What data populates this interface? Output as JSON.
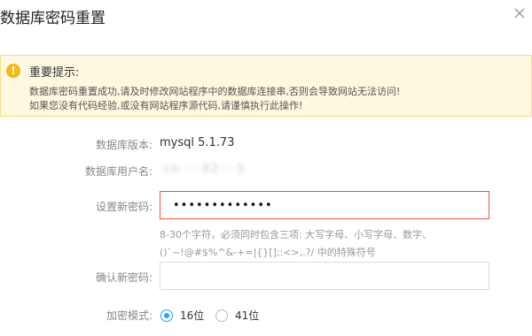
{
  "dialog": {
    "title": "数据库密码重置",
    "close_icon": "close-icon"
  },
  "notice": {
    "icon": "warning-icon",
    "icon_glyph": "!",
    "title": "重要提示:",
    "line1": "数据库密码重置成功,请及时修改网站程序中的数据库连接串,否则会导致网站无法访问!",
    "line2": "如果您没有代码经验,或没有网站程序源代码,请谨慎执行此操作!"
  },
  "form": {
    "db_version_label": "数据库版本:",
    "db_version_value": "mysql 5.1.73",
    "db_user_label": "数据库用户名:",
    "db_user_value": "·ch·····82····5",
    "new_password_label": "设置新密码:",
    "new_password_value": "•••••••••••••",
    "hint_line1": "8-30个字符，必须同时包含三项: 大写字母、小写字母、数字、",
    "hint_line2": "()`~!@#$%^&-+=|{}[];:<>,.?/ 中的特殊符号",
    "confirm_password_label": "确认新密码:",
    "confirm_password_value": "",
    "encrypt_mode_label": "加密模式:",
    "encrypt_options": [
      {
        "label": "16位",
        "checked": true
      },
      {
        "label": "41位",
        "checked": false
      }
    ]
  },
  "colors": {
    "accent": "#20a0ff",
    "error_border": "#e2593f",
    "notice_bg": "#fdf8df",
    "notice_border": "#f5df8d",
    "warning_icon": "#f2b81c"
  }
}
